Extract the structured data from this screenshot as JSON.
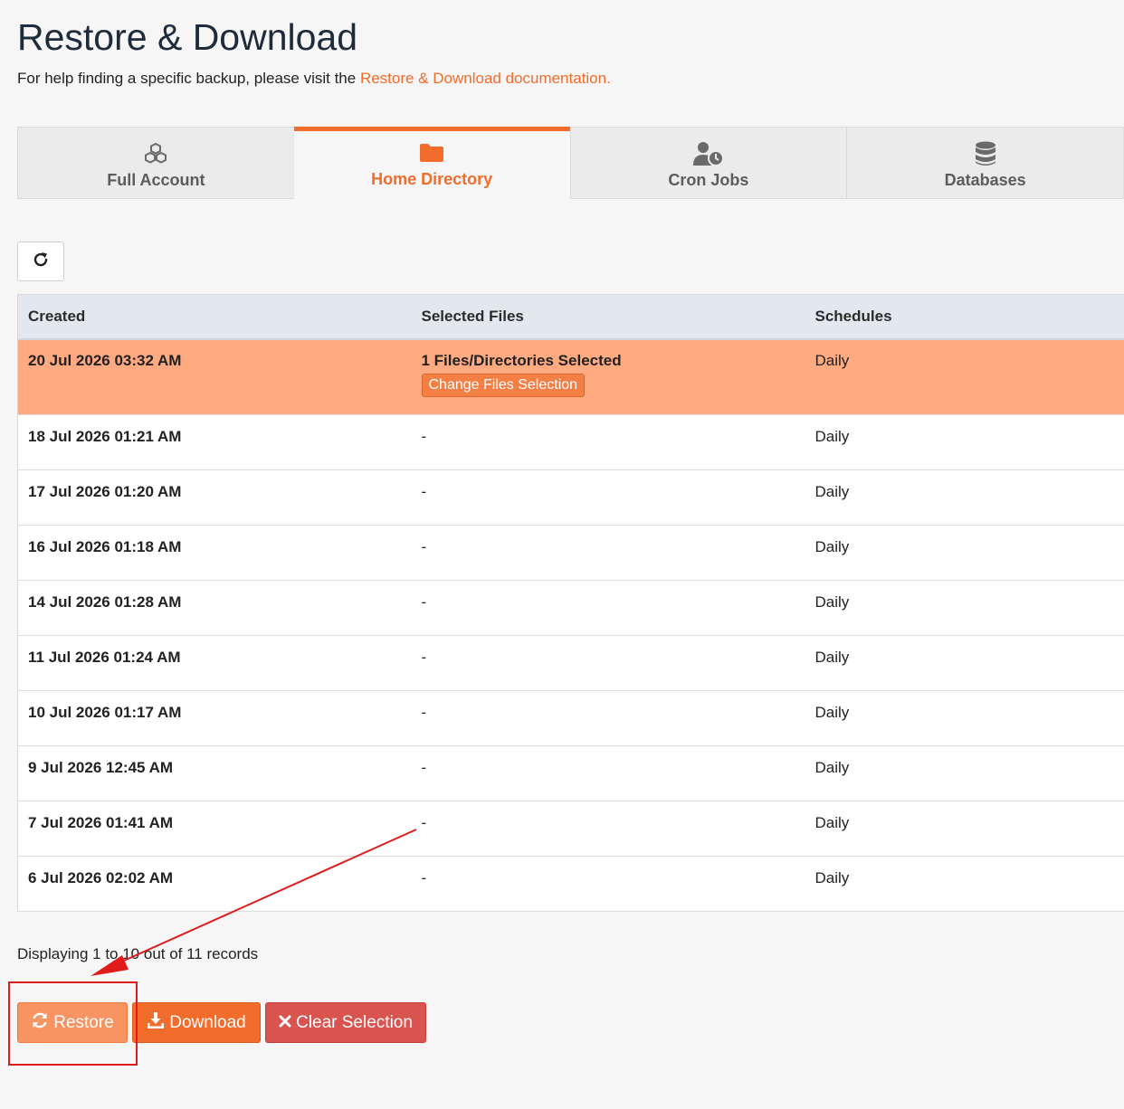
{
  "header": {
    "title": "Restore & Download",
    "help_prefix": "For help finding a specific backup, please visit the ",
    "help_link": "Restore & Download documentation."
  },
  "tabs": [
    {
      "label": "Full Account",
      "icon": "cubes-icon",
      "active": false
    },
    {
      "label": "Home Directory",
      "icon": "folder-icon",
      "active": true
    },
    {
      "label": "Cron Jobs",
      "icon": "user-clock-icon",
      "active": false
    },
    {
      "label": "Databases",
      "icon": "database-icon",
      "active": false
    }
  ],
  "table": {
    "headers": {
      "created": "Created",
      "selected_files": "Selected Files",
      "schedules": "Schedules"
    },
    "rows": [
      {
        "created": "20 Jul 2026 03:32 AM",
        "files": "1 Files/Directories Selected",
        "action": "Change Files Selection",
        "schedule": "Daily",
        "selected": true
      },
      {
        "created": "18 Jul 2026 01:21 AM",
        "files": "-",
        "schedule": "Daily"
      },
      {
        "created": "17 Jul 2026 01:20 AM",
        "files": "-",
        "schedule": "Daily"
      },
      {
        "created": "16 Jul 2026 01:18 AM",
        "files": "-",
        "schedule": "Daily"
      },
      {
        "created": "14 Jul 2026 01:28 AM",
        "files": "-",
        "schedule": "Daily"
      },
      {
        "created": "11 Jul 2026 01:24 AM",
        "files": "-",
        "schedule": "Daily"
      },
      {
        "created": "10 Jul 2026 01:17 AM",
        "files": "-",
        "schedule": "Daily"
      },
      {
        "created": "9 Jul 2026 12:45 AM",
        "files": "-",
        "schedule": "Daily"
      },
      {
        "created": "7 Jul 2026 01:41 AM",
        "files": "-",
        "schedule": "Daily"
      },
      {
        "created": "6 Jul 2026 02:02 AM",
        "files": "-",
        "schedule": "Daily"
      }
    ]
  },
  "records_info": "Displaying 1 to 10 out of 11 records",
  "actions": {
    "restore_label": "Restore",
    "download_label": "Download",
    "clear_label": "Clear Selection"
  },
  "colors": {
    "accent": "#f26c2b",
    "selected_row": "#ffaa80",
    "danger": "#d9534f",
    "annotation": "#e01b1b"
  }
}
